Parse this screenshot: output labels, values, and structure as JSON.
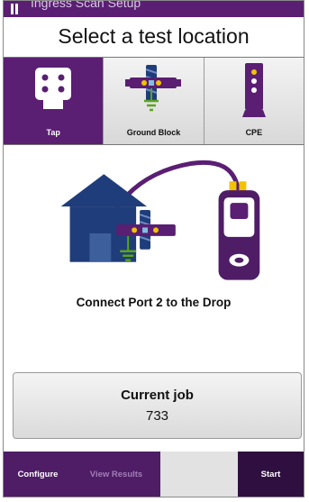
{
  "app": {
    "window_title": "Ingress Scan Setup"
  },
  "page": {
    "heading": "Select a test location"
  },
  "tabs": [
    {
      "label": "Tap",
      "icon": "tap-faceplate-icon",
      "selected": true
    },
    {
      "label": "Ground Block",
      "icon": "ground-block-icon",
      "selected": false
    },
    {
      "label": "CPE",
      "icon": "cpe-device-icon",
      "selected": false
    }
  ],
  "illustration": {
    "icons": [
      "house-icon",
      "ground-block-icon",
      "test-meter-icon",
      "drop-cable-icon"
    ],
    "instruction": "Connect Port 2 to the Drop"
  },
  "job": {
    "title": "Current job",
    "value": "733"
  },
  "bottom_bar": {
    "configure": "Configure",
    "view_results": "View Results",
    "start": "Start"
  },
  "colors": {
    "brand_purple": "#5a1e73",
    "dark_purple": "#2f0f40",
    "accent_yellow": "#f2c200",
    "ground_green": "#5aa51e",
    "house_blue": "#1f3d7a"
  }
}
